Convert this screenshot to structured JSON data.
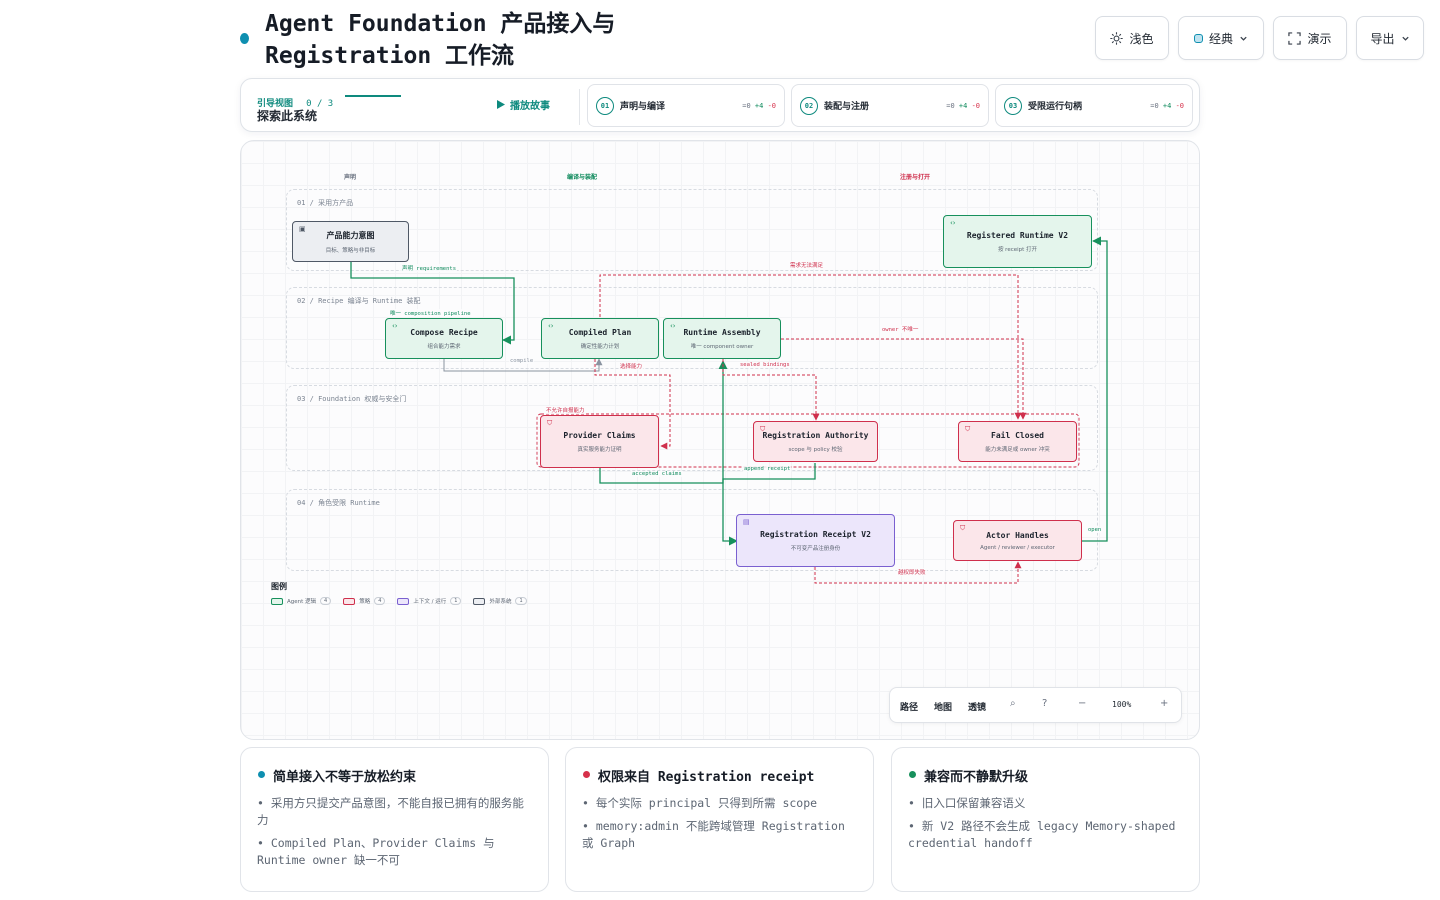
{
  "header": {
    "title": "Agent Foundation 产品接入与\nRegistration 工作流",
    "buttons": [
      {
        "id": "theme",
        "label": "浅色",
        "icon": "sun-icon"
      },
      {
        "id": "style",
        "label": "经典",
        "icon": "palette-dot-icon"
      },
      {
        "id": "present",
        "label": "演示",
        "icon": "fullscreen-icon"
      },
      {
        "id": "export",
        "label": "导出",
        "icon": "chevron-down-icon"
      }
    ]
  },
  "guide": {
    "label": "引导视图",
    "count": "0 / 3",
    "subtitle": "探索此系统",
    "play_label": "播放故事",
    "steps": [
      {
        "num": "01",
        "label": "声明与编译",
        "eq": "=0",
        "plus": "+4",
        "minus": "-0"
      },
      {
        "num": "02",
        "label": "装配与注册",
        "eq": "=0",
        "plus": "+4",
        "minus": "-0"
      },
      {
        "num": "03",
        "label": "受限运行句柄",
        "eq": "=0",
        "plus": "+4",
        "minus": "-0"
      }
    ]
  },
  "diagram": {
    "columns": [
      "声明",
      "编译与装配",
      "注册与打开"
    ],
    "lanes": [
      "01 / 采用方产品",
      "02 / Recipe 编译与 Runtime 装配",
      "03 / Foundation 权威与安全门",
      "04 / 角色受限 Runtime"
    ],
    "nodes": {
      "intent": {
        "title": "产品能力意图",
        "sub": "目标、策略与非目标"
      },
      "recipe": {
        "title": "Compose Recipe",
        "sub": "组合能力需求"
      },
      "plan": {
        "title": "Compiled Plan",
        "sub": "确定性能力计划"
      },
      "assembly": {
        "title": "Runtime Assembly",
        "sub": "唯一 component owner"
      },
      "registered": {
        "title": "Registered Runtime V2",
        "sub": "按 receipt 打开"
      },
      "claims": {
        "title": "Provider Claims",
        "sub": "真实服务能力证明"
      },
      "authority": {
        "title": "Registration Authority",
        "sub": "scope 与 policy 校验"
      },
      "failclosed": {
        "title": "Fail Closed",
        "sub": "能力未满足或 owner 冲突"
      },
      "receipt": {
        "title": "Registration Receipt V2",
        "sub": "不可变产品注册身份"
      },
      "handles": {
        "title": "Actor Handles",
        "sub": "Agent / reviewer / executor"
      }
    },
    "edges": {
      "declare": "声明 requirements",
      "pipeline": "唯一 composition pipeline",
      "compile": "compile",
      "unmet": "需求无法满足",
      "owner_conflict": "owner 不唯一",
      "select_provider": "选择能力",
      "sealed": "sealed bindings",
      "no_self_report": "不允许自报能力",
      "accepted": "accepted claims",
      "append": "append receipt",
      "open": "open",
      "escalation": "越权即失败"
    },
    "legend": {
      "title": "图例",
      "items": [
        {
          "label": "Agent 逻辑",
          "count": "4",
          "color": "#17905c"
        },
        {
          "label": "策略",
          "count": "4",
          "color": "#cf2f4c"
        },
        {
          "label": "上下文 / 运行",
          "count": "1",
          "color": "#7a60d0"
        },
        {
          "label": "外部系统",
          "count": "1",
          "color": "#4f5866"
        }
      ]
    },
    "toolbar": {
      "path": "路径",
      "map": "地图",
      "lens": "透镜",
      "zoom": "100%"
    }
  },
  "cards": [
    {
      "title": "简单接入不等于放松约束",
      "color": "#0e8fb0",
      "items": [
        "采用方只提交产品意图，不能自报已拥有的服务能力",
        "Compiled Plan、Provider Claims 与 Runtime owner 缺一不可"
      ]
    },
    {
      "title": "权限来自 Registration receipt",
      "color": "#d6304a",
      "items": [
        "每个实际 principal 只得到所需 scope",
        "memory:admin 不能跨域管理 Registration 或 Graph"
      ]
    },
    {
      "title": "兼容而不静默升级",
      "color": "#17905c",
      "items": [
        "旧入口保留兼容语义",
        "新 V2 路径不会生成 legacy Memory-shaped credential handoff"
      ]
    }
  ]
}
